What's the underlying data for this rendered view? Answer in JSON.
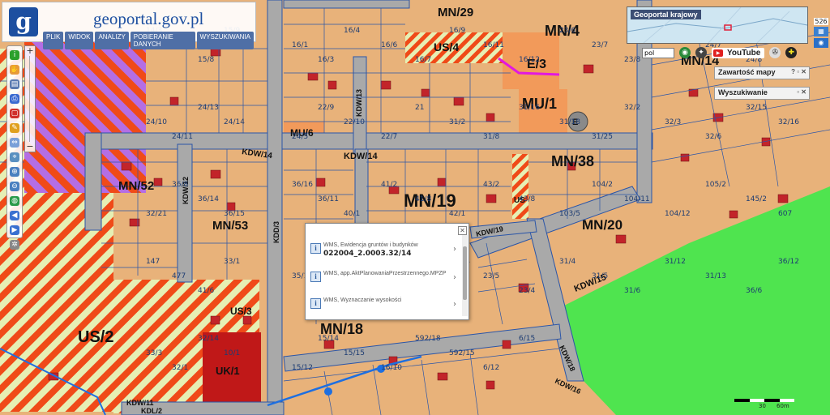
{
  "header": {
    "logo_letter": "g",
    "site_title": "geoportal.gov.pl",
    "menu": [
      {
        "label": "PLIK"
      },
      {
        "label": "WIDOK"
      },
      {
        "label": "ANALIZY"
      },
      {
        "label": "POBIERANIE DANYCH"
      },
      {
        "label": "WYSZUKIWANIA"
      }
    ]
  },
  "overview": {
    "title": "Geoportal krajowy"
  },
  "tools": {
    "lang": "pol",
    "youtube": "YouTube"
  },
  "panels": {
    "map_contents": "Zawartość mapy",
    "search": "Wyszukiwanie"
  },
  "right_edge": {
    "number": "526"
  },
  "scale": {
    "mid": "30",
    "end": "60m"
  },
  "zoom": {
    "plus": "+",
    "minus": "−"
  },
  "popup": {
    "rows": [
      {
        "source": "WMS, Ewidencja gruntów i budynków",
        "value": "022004_2.0003.32/14"
      },
      {
        "source": "WMS, app.AktPlanowaniaPrzestrzennego.MPZP",
        "value": ""
      },
      {
        "source": "WMS, Wyznaczanie wysokości",
        "value": ""
      }
    ]
  },
  "map": {
    "colors": {
      "residential": "#e8b27a",
      "green": "#4fe44f",
      "road": "#a9a9a9",
      "service": "#f29a5a",
      "hatch_red": "#f04a18",
      "hatch_green": "#e6efb4",
      "utility": "#c01818",
      "violet": "#b46ee4",
      "parcel_line": "#2a55a8",
      "building": "#c2242a"
    },
    "zones": [
      "US/4",
      "MN/29",
      "MN/4",
      "E/3",
      "MN/14",
      "MU/1",
      "MU/6",
      "E",
      "MN/38",
      "MN/52",
      "MN/53",
      "MN/19",
      "MN/20",
      "US/2",
      "UK/1",
      "MN/18",
      "US",
      "US/3"
    ],
    "roads": [
      "KDW/14",
      "KDW/14",
      "KDD/3",
      "KDW/12",
      "KDW/13",
      "KDW/15",
      "KDW/16",
      "KDW/19",
      "KDW/18",
      "KDL/2",
      "KDW/11"
    ],
    "parcels": [
      "14/3",
      "14/6",
      "15/8",
      "15/9",
      "16/1",
      "16/3",
      "16/4",
      "16/6",
      "16/7",
      "16/9",
      "16/11",
      "16/12",
      "23/6",
      "23/7",
      "23/8",
      "23/10",
      "24/7",
      "24/8",
      "24/9",
      "24/10",
      "24/11",
      "24/13",
      "24/14",
      "24/5",
      "22/9",
      "22/10",
      "22/7",
      "21",
      "31/2",
      "31/8",
      "31/16",
      "31/18",
      "31/25",
      "32/2",
      "32/3",
      "32/6",
      "32/15",
      "32/16",
      "32/21",
      "36/8",
      "36/14",
      "36/15",
      "36/16",
      "36/11",
      "40/1",
      "41/2",
      "41/8",
      "42/1",
      "43/2",
      "43/8",
      "103/5",
      "104/2",
      "104/11",
      "104/12",
      "105/2",
      "145/2",
      "607",
      "147",
      "477",
      "41/6",
      "33/1",
      "35/13",
      "23/16",
      "23/18",
      "23/21",
      "23/22",
      "23/24",
      "23/5",
      "23/4",
      "31/4",
      "31/5",
      "31/6",
      "31/12",
      "31/13",
      "36/6",
      "36/12",
      "33/3",
      "32/1",
      "32/14",
      "10/1",
      "15/12",
      "15/14",
      "15/15",
      "16/10",
      "592/18",
      "592/15",
      "6/12",
      "6/15"
    ]
  }
}
